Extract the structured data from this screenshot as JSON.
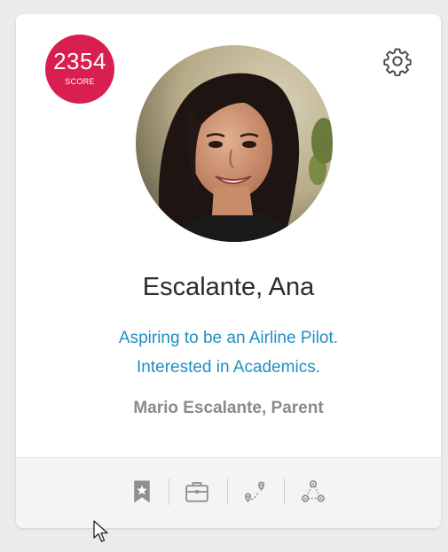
{
  "profile": {
    "score": "2354",
    "score_label": "SCORE",
    "name": "Escalante, Ana",
    "tagline_line1": "Aspiring to be an Airline Pilot.",
    "tagline_line2": "Interested in Academics.",
    "parent": "Mario Escalante, Parent"
  },
  "footer": {
    "icons": [
      "bookmark-icon",
      "briefcase-icon",
      "route-icon",
      "network-icon"
    ]
  },
  "colors": {
    "score_badge": "#d91f4f",
    "tagline": "#1f8fc4",
    "parent": "#8a8a8a",
    "footer_bg": "#f4f4f4"
  }
}
